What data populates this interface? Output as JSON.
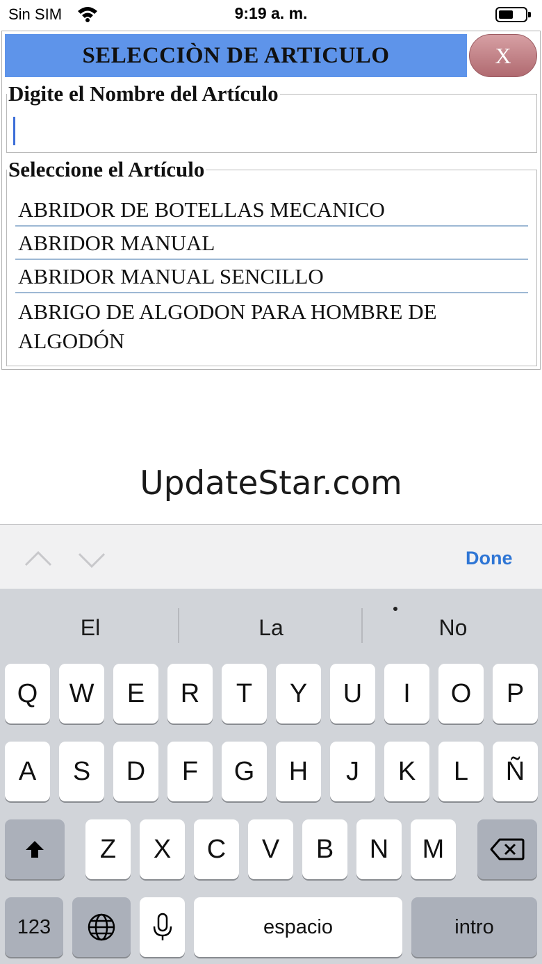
{
  "status_bar": {
    "carrier": "Sin SIM",
    "time": "9:19 a. m.",
    "battery_level": 0.55
  },
  "dialog": {
    "title": "SELECCIÒN DE ARTICULO",
    "close_label": "X",
    "name_label": "Digite el Nombre del Artículo",
    "name_value": "",
    "list_label": "Seleccione el Artículo",
    "items": [
      "ABRIDOR DE BOTELLAS MECANICO",
      "ABRIDOR MANUAL",
      "ABRIDOR MANUAL SENCILLO",
      "ABRIGO DE ALGODON PARA HOMBRE DE ALGODÓN"
    ]
  },
  "watermark": "UpdateStar.com",
  "accessory": {
    "done_label": "Done"
  },
  "keyboard": {
    "suggestions": [
      "El",
      "La",
      "No"
    ],
    "row1": [
      "Q",
      "W",
      "E",
      "R",
      "T",
      "Y",
      "U",
      "I",
      "O",
      "P"
    ],
    "row2": [
      "A",
      "S",
      "D",
      "F",
      "G",
      "H",
      "J",
      "K",
      "L",
      "Ñ"
    ],
    "row3": [
      "Z",
      "X",
      "C",
      "V",
      "B",
      "N",
      "M"
    ],
    "numbers_label": "123",
    "space_label": "espacio",
    "return_label": "intro"
  },
  "colors": {
    "title_bar": "#5e94ea",
    "done": "#2f76d5",
    "keyboard_bg": "#d1d4d9"
  }
}
